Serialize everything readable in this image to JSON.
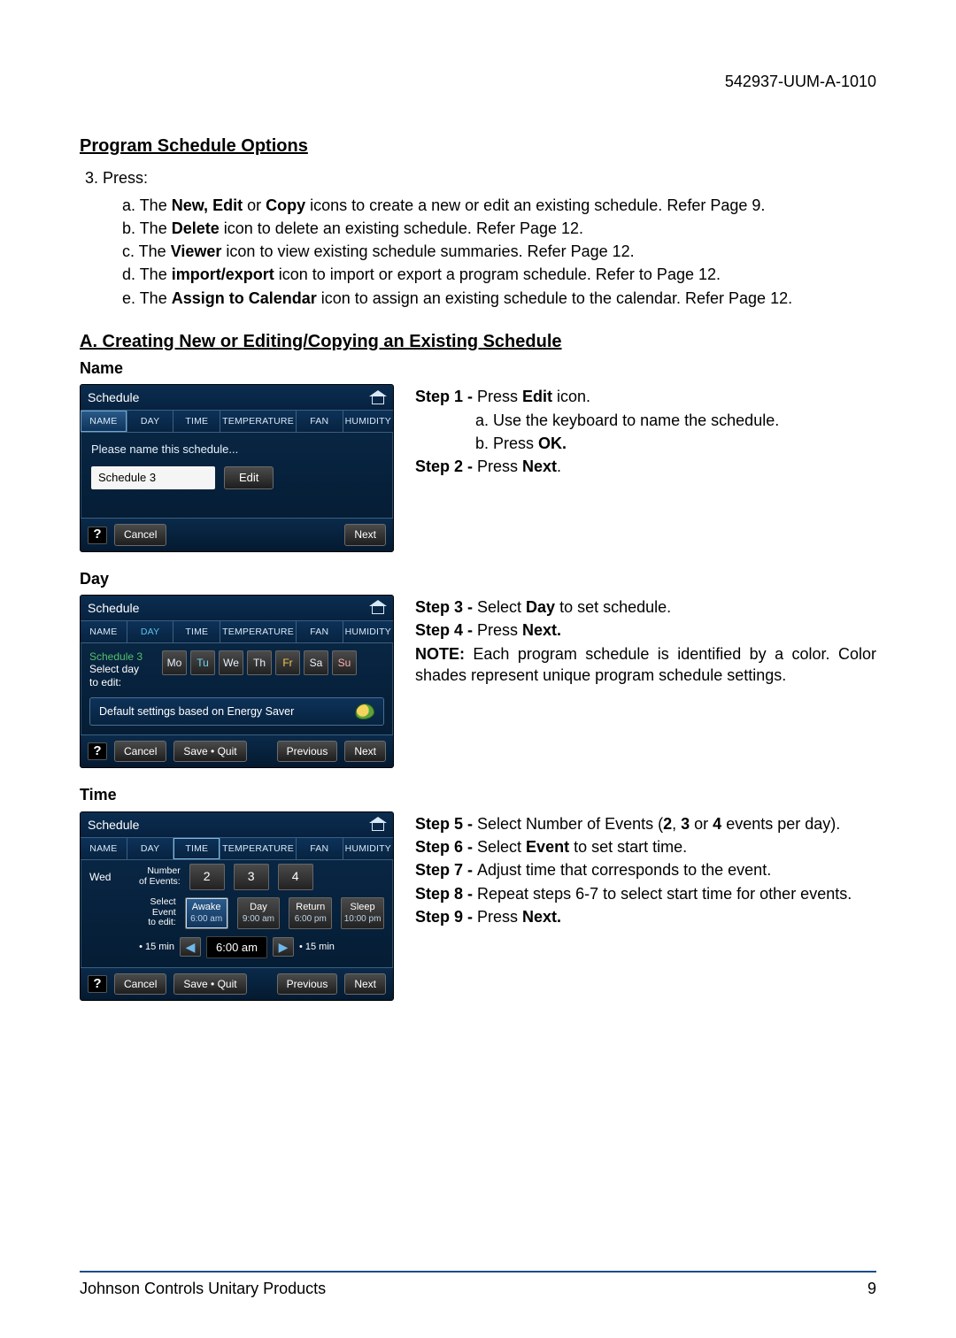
{
  "doc_id": "542937-UUM-A-1010",
  "h1": "Program Schedule Options",
  "item3_label": "3.  Press:",
  "subs": {
    "a": {
      "pre": "a. The ",
      "b": "New, Edit",
      "mid": " or ",
      "b2": "Copy",
      "post": " icons to create a new or edit an existing schedule. Refer Page 9."
    },
    "b": {
      "pre": "b. The ",
      "b": "Delete",
      "post": " icon to delete an existing schedule. Refer Page 12."
    },
    "c": {
      "pre": "c. The ",
      "b": "Viewer",
      "post": " icon to view existing schedule summaries. Refer Page 12."
    },
    "d": {
      "pre": "d. The ",
      "b": "import/export",
      "post": " icon to import or export a program schedule. Refer to Page 12."
    },
    "e": {
      "pre": "e. The ",
      "b": "Assign to Calendar",
      "post": " icon to assign an existing schedule to the calendar. Refer Page 12."
    }
  },
  "h2": "A. Creating New or Editing/Copying an Existing Schedule",
  "section_name": "Name",
  "section_day": "Day",
  "section_time": "Time",
  "panel_title": "Schedule",
  "tabs": [
    "NAME",
    "DAY",
    "TIME",
    "TEMPERATURE",
    "FAN",
    "HUMIDITY"
  ],
  "name_panel": {
    "prompt": "Please name this schedule...",
    "value": "Schedule 3",
    "edit_btn": "Edit",
    "help": "?",
    "cancel": "Cancel",
    "next": "Next"
  },
  "name_steps": {
    "s1_label": "Step 1 - ",
    "s1_text": "Press ",
    "s1_b": "Edit",
    "s1_post": " icon.",
    "s1a": "a. Use the keyboard to name the schedule.",
    "s1b_pre": "b. Press ",
    "s1b_b": "OK.",
    "s2_label": "Step 2 - ",
    "s2_text": "Press ",
    "s2_b": "Next",
    "s2_post": "."
  },
  "day_panel": {
    "sched": "Schedule 3",
    "select_lbl1": "Select day",
    "select_lbl2": "to edit:",
    "days": [
      "Mo",
      "Tu",
      "We",
      "Th",
      "Fr",
      "Sa",
      "Su"
    ],
    "energy": "Default settings based on Energy Saver",
    "cancel": "Cancel",
    "savequit": "Save • Quit",
    "previous": "Previous",
    "next": "Next"
  },
  "day_steps": {
    "s3_label": "Step 3 - ",
    "s3_text": "Select ",
    "s3_b": "Day",
    "s3_post": " to set schedule.",
    "s4_label": "Step 4 - ",
    "s4_text": "Press ",
    "s4_b": "Next.",
    "note_label": "NOTE:",
    "note_text": " Each program schedule is identified by a color. Color shades represent unique program schedule settings."
  },
  "time_panel": {
    "day": "Wed",
    "numlabel1": "Number",
    "numlabel2": "of Events:",
    "nums": [
      "2",
      "3",
      "4"
    ],
    "evt_label1": "Select Event",
    "evt_label2": "to edit:",
    "events": [
      {
        "name": "Awake",
        "time": "6:00 am"
      },
      {
        "name": "Day",
        "time": "9:00 am"
      },
      {
        "name": "Return",
        "time": "6:00 pm"
      },
      {
        "name": "Sleep",
        "time": "10:00 pm"
      }
    ],
    "minus": "- 15 min",
    "minus2": "• 15 min",
    "time_val": "6:00 am",
    "cancel": "Cancel",
    "savequit": "Save • Quit",
    "previous": "Previous",
    "next": "Next"
  },
  "time_steps": {
    "s5_label": "Step 5 - ",
    "s5_text": "Select Number of Events (",
    "s5_b1": "2",
    "s5_mid": ", ",
    "s5_b2": "3",
    "s5_mid2": " or ",
    "s5_b3": "4",
    "s5_post": " events per day).",
    "s6_label": "Step 6 - ",
    "s6_text": "Select ",
    "s6_b": "Event",
    "s6_post": " to set start time.",
    "s7_label": "Step 7 - ",
    "s7_text": "Adjust time that corresponds to the event.",
    "s8_label": "Step 8 - ",
    "s8_text": "Repeat steps 6-7 to select start time for other events.",
    "s9_label": "Step 9 - ",
    "s9_text": "Press ",
    "s9_b": "Next."
  },
  "footer_left": "Johnson Controls Unitary Products",
  "footer_right": "9"
}
